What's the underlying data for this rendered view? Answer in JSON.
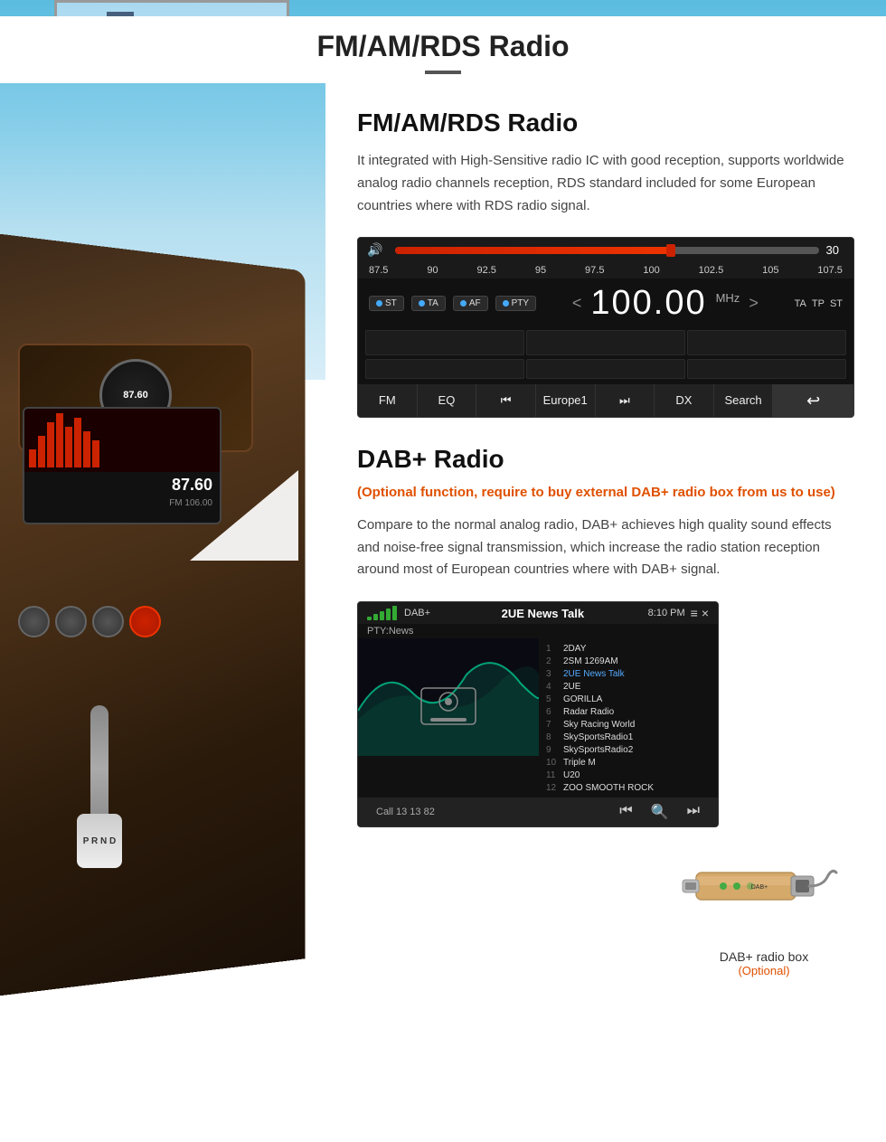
{
  "page": {
    "title": "FM/AM/RDS Radio",
    "title_underline": true
  },
  "fm_section": {
    "title": "FM/AM/RDS Radio",
    "description": "It integrated with High-Sensitive radio IC with good reception, supports worldwide analog radio channels reception, RDS standard included for some European countries where with RDS radio signal.",
    "radio_ui": {
      "volume": "30",
      "volume_icon": "🔊",
      "progress_percent": 65,
      "freq_scale": [
        "87.5",
        "90",
        "92.5",
        "95",
        "97.5",
        "100",
        "102.5",
        "105",
        "107.5"
      ],
      "buttons_row1": [
        "ST",
        "TA",
        "AF",
        "PTY"
      ],
      "current_freq": "100.00",
      "freq_unit": "MHz",
      "right_buttons": [
        "TA",
        "TP",
        "ST"
      ],
      "bottom_buttons": [
        "FM",
        "EQ",
        "⏮",
        "Europe1",
        "⏭",
        "DX",
        "Search"
      ],
      "back_icon": "↩"
    }
  },
  "dab_section": {
    "title": "DAB+ Radio",
    "optional_text": "(Optional function, require to buy external DAB+ radio box from us to use)",
    "description": "Compare to the normal analog radio, DAB+ achieves high quality sound effects and noise-free signal transmission, which increase the radio station reception around most of European countries where with DAB+ signal.",
    "dab_ui": {
      "label": "DAB+",
      "signal_bars": [
        4,
        7,
        10,
        13,
        16
      ],
      "current_station": "2UE News Talk",
      "pty": "PTY:News",
      "time": "8:10 PM",
      "channels": [
        {
          "num": "1",
          "name": "2DAY"
        },
        {
          "num": "2",
          "name": "2SM 1269AM"
        },
        {
          "num": "3",
          "name": "2UE News Talk",
          "active": true
        },
        {
          "num": "4",
          "name": "2UE"
        },
        {
          "num": "5",
          "name": "GORILLA"
        },
        {
          "num": "6",
          "name": "Radar Radio"
        },
        {
          "num": "7",
          "name": "Sky Racing World"
        },
        {
          "num": "8",
          "name": "SkySportsRadio1"
        },
        {
          "num": "9",
          "name": "SkySportsRadio2"
        },
        {
          "num": "10",
          "name": "Triple M"
        },
        {
          "num": "11",
          "name": "U20"
        },
        {
          "num": "12",
          "name": "ZOO SMOOTH ROCK"
        }
      ],
      "call_text": "Call 13 13 82",
      "bottom_icons": [
        "⏮",
        "🔍",
        "⏭"
      ]
    },
    "radio_box_label": "DAB+ radio box",
    "radio_box_optional": "(Optional)"
  }
}
